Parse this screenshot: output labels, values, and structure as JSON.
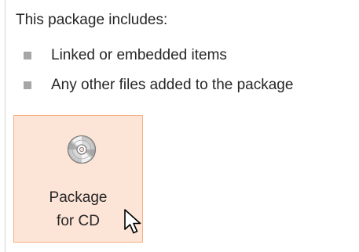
{
  "panel": {
    "heading": "This package includes:",
    "items": [
      {
        "label": "Linked or embedded items"
      },
      {
        "label": "Any other files added to the package"
      }
    ]
  },
  "package_button": {
    "line1": "Package",
    "line2": "for CD",
    "icon": "cd-disc-icon"
  },
  "colors": {
    "button_fill": "#fce4d6",
    "button_border": "#f4b183",
    "bullet": "#a6a6a6",
    "text": "#262626"
  }
}
